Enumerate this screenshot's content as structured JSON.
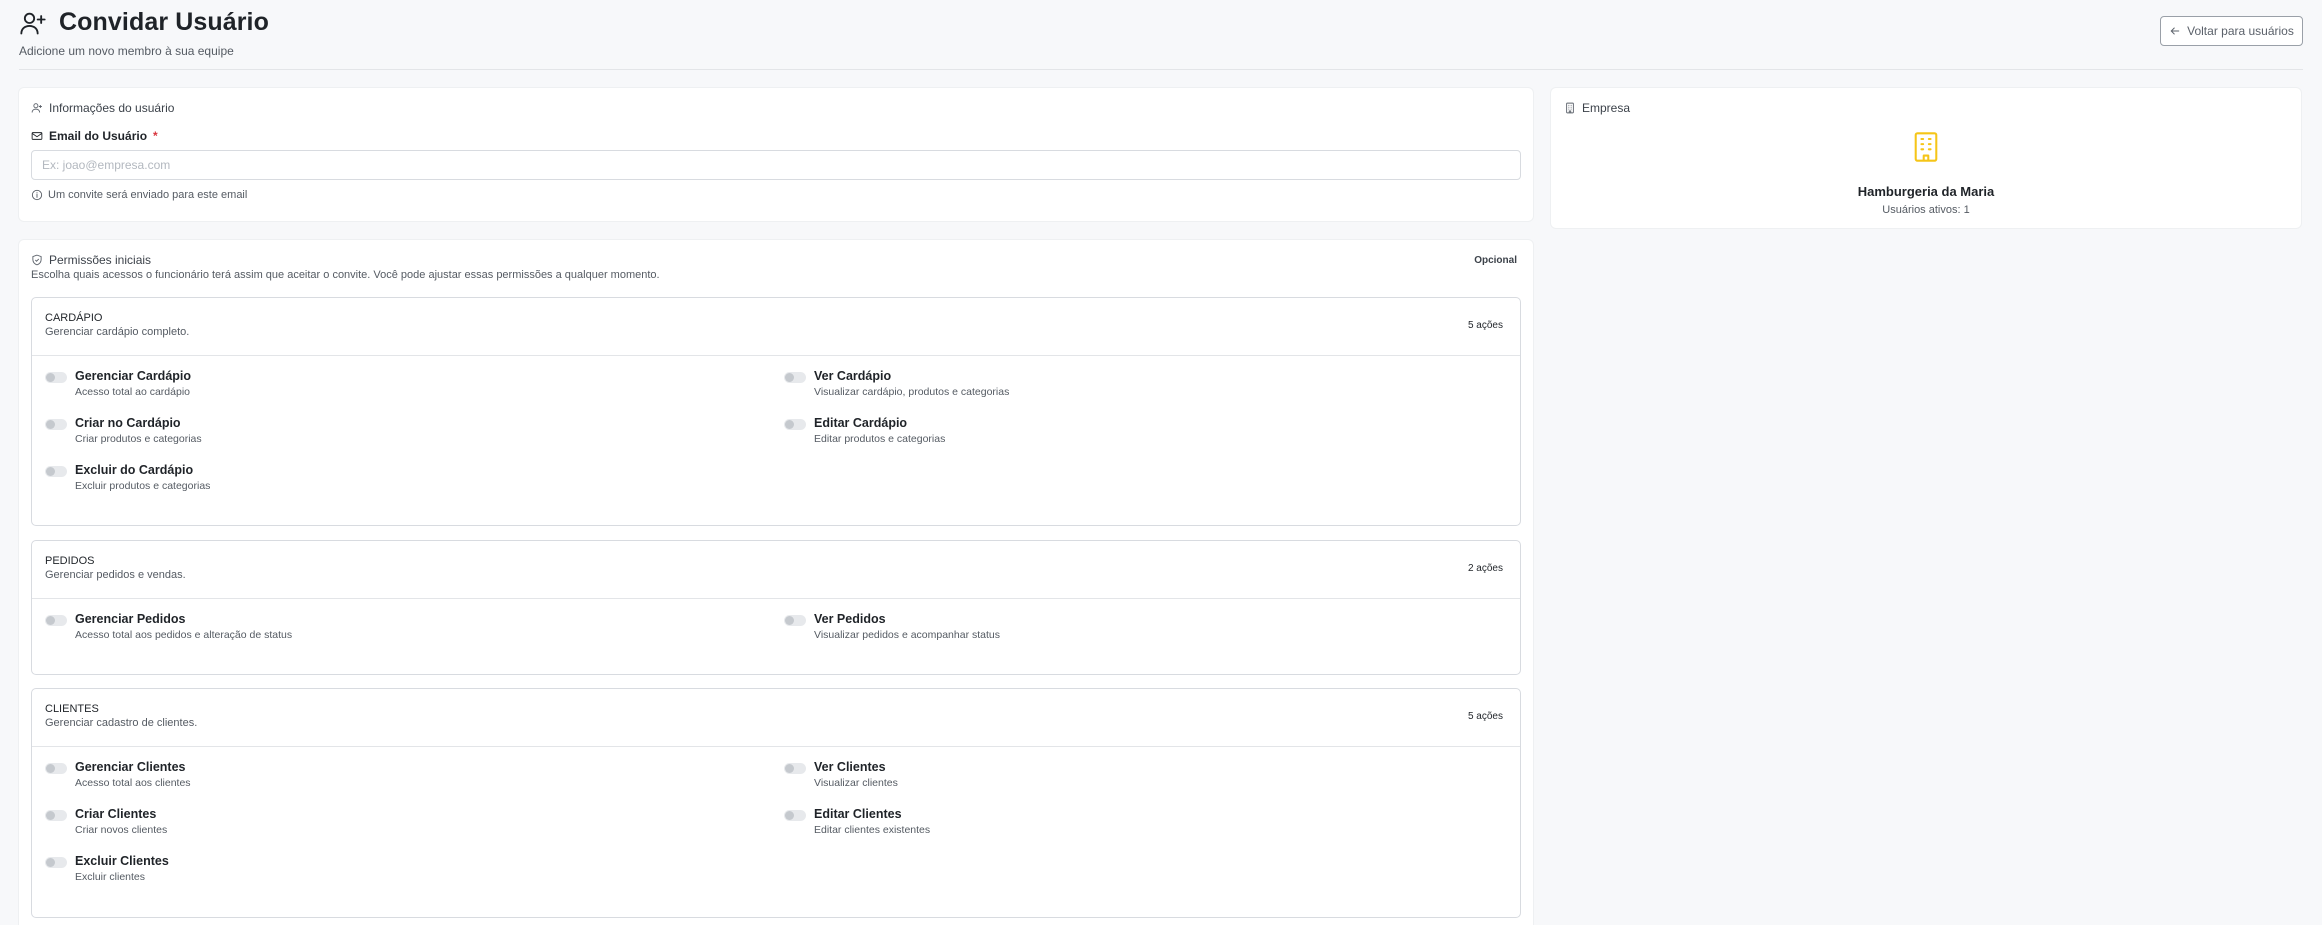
{
  "header": {
    "title": "Convidar Usuário",
    "subtitle": "Adicione um novo membro à sua equipe",
    "back_label": "Voltar para usuários"
  },
  "user_info": {
    "title": "Informações do usuário",
    "email_label": "Email do Usuário",
    "required_mark": "*",
    "email_value": "",
    "email_placeholder": "Ex: joao@empresa.com",
    "hint": "Um convite será enviado para este email"
  },
  "permissions": {
    "title": "Permissões iniciais",
    "badge": "Opcional",
    "description": "Escolha quais acessos o funcionário terá assim que aceitar o convite. Você pode ajustar essas permissões a qualquer momento.",
    "groups": [
      {
        "name": "CARDÁPIO",
        "description": "Gerenciar cardápio completo.",
        "count": "5 ações",
        "items": [
          {
            "name": "Gerenciar Cardápio",
            "sub": "Acesso total ao cardápio",
            "enabled": false
          },
          {
            "name": "Ver Cardápio",
            "sub": "Visualizar cardápio, produtos e categorias",
            "enabled": false
          },
          {
            "name": "Criar no Cardápio",
            "sub": "Criar produtos e categorias",
            "enabled": false
          },
          {
            "name": "Editar Cardápio",
            "sub": "Editar produtos e categorias",
            "enabled": false
          },
          {
            "name": "Excluir do Cardápio",
            "sub": "Excluir produtos e categorias",
            "enabled": false
          }
        ]
      },
      {
        "name": "PEDIDOS",
        "description": "Gerenciar pedidos e vendas.",
        "count": "2 ações",
        "items": [
          {
            "name": "Gerenciar Pedidos",
            "sub": "Acesso total aos pedidos e alteração de status",
            "enabled": false
          },
          {
            "name": "Ver Pedidos",
            "sub": "Visualizar pedidos e acompanhar status",
            "enabled": false
          }
        ]
      },
      {
        "name": "CLIENTES",
        "description": "Gerenciar cadastro de clientes.",
        "count": "5 ações",
        "items": [
          {
            "name": "Gerenciar Clientes",
            "sub": "Acesso total aos clientes",
            "enabled": false
          },
          {
            "name": "Ver Clientes",
            "sub": "Visualizar clientes",
            "enabled": false
          },
          {
            "name": "Criar Clientes",
            "sub": "Criar novos clientes",
            "enabled": false
          },
          {
            "name": "Editar Clientes",
            "sub": "Editar clientes existentes",
            "enabled": false
          },
          {
            "name": "Excluir Clientes",
            "sub": "Excluir clientes",
            "enabled": false
          }
        ]
      }
    ]
  },
  "company": {
    "title": "Empresa",
    "name": "Hamburgeria da Maria",
    "active_users": "Usuários ativos: 1",
    "icon": "building-icon",
    "icon_color": "#f5c518"
  },
  "colors": {
    "background": "#f7f8fa",
    "card": "#ffffff",
    "border": "#d8dbe0",
    "required": "#d9363e"
  }
}
